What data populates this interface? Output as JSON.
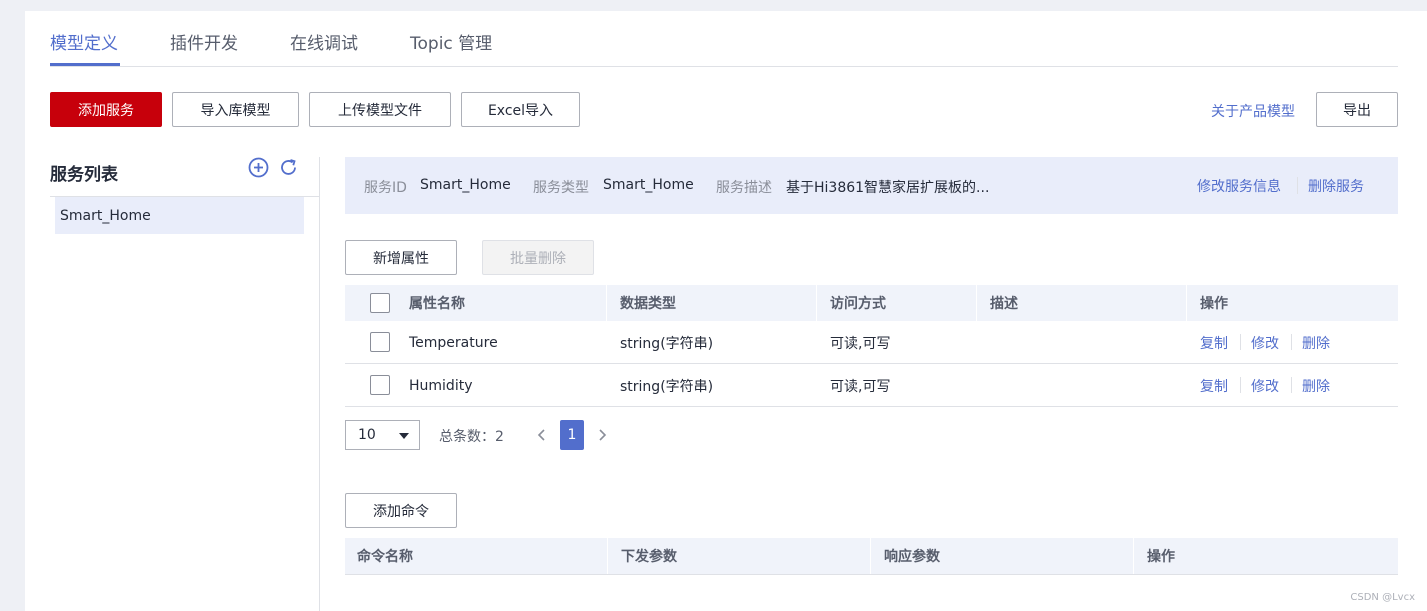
{
  "tabs": [
    {
      "label": "模型定义",
      "active": true
    },
    {
      "label": "插件开发",
      "active": false
    },
    {
      "label": "在线调试",
      "active": false
    },
    {
      "label": "Topic 管理",
      "active": false
    }
  ],
  "toolbar": {
    "add_service": "添加服务",
    "import_library_model": "导入库模型",
    "upload_model_file": "上传模型文件",
    "excel_import": "Excel导入",
    "about_product_model": "关于产品模型",
    "export": "导出"
  },
  "sidebar": {
    "title": "服务列表",
    "add_icon": "plus-circle-icon",
    "refresh_icon": "refresh-icon",
    "items": [
      {
        "label": "Smart_Home",
        "selected": true
      }
    ]
  },
  "service_info": {
    "id_label": "服务ID",
    "id_value": "Smart_Home",
    "type_label": "服务类型",
    "type_value": "Smart_Home",
    "desc_label": "服务描述",
    "desc_value": "基于Hi3861智慧家居扩展板的...",
    "edit_link": "修改服务信息",
    "delete_link": "删除服务"
  },
  "properties": {
    "add_button": "新增属性",
    "batch_delete_button": "批量删除",
    "columns": [
      "属性名称",
      "数据类型",
      "访问方式",
      "描述",
      "操作"
    ],
    "rows": [
      {
        "name": "Temperature",
        "type": "string(字符串)",
        "access": "可读,可写",
        "desc": "",
        "ops": [
          "复制",
          "修改",
          "删除"
        ]
      },
      {
        "name": "Humidity",
        "type": "string(字符串)",
        "access": "可读,可写",
        "desc": "",
        "ops": [
          "复制",
          "修改",
          "删除"
        ]
      }
    ]
  },
  "pagination": {
    "page_size": "10",
    "total_label": "总条数：2",
    "current_page": "1"
  },
  "commands": {
    "add_button": "添加命令",
    "columns": [
      "命令名称",
      "下发参数",
      "响应参数",
      "操作"
    ]
  },
  "colors": {
    "primary_red": "#c7000b",
    "link_blue": "#526ecc",
    "highlight_bg": "#e9edfa",
    "header_bg": "#f0f3fa"
  },
  "watermark": "CSDN @Lvcx"
}
